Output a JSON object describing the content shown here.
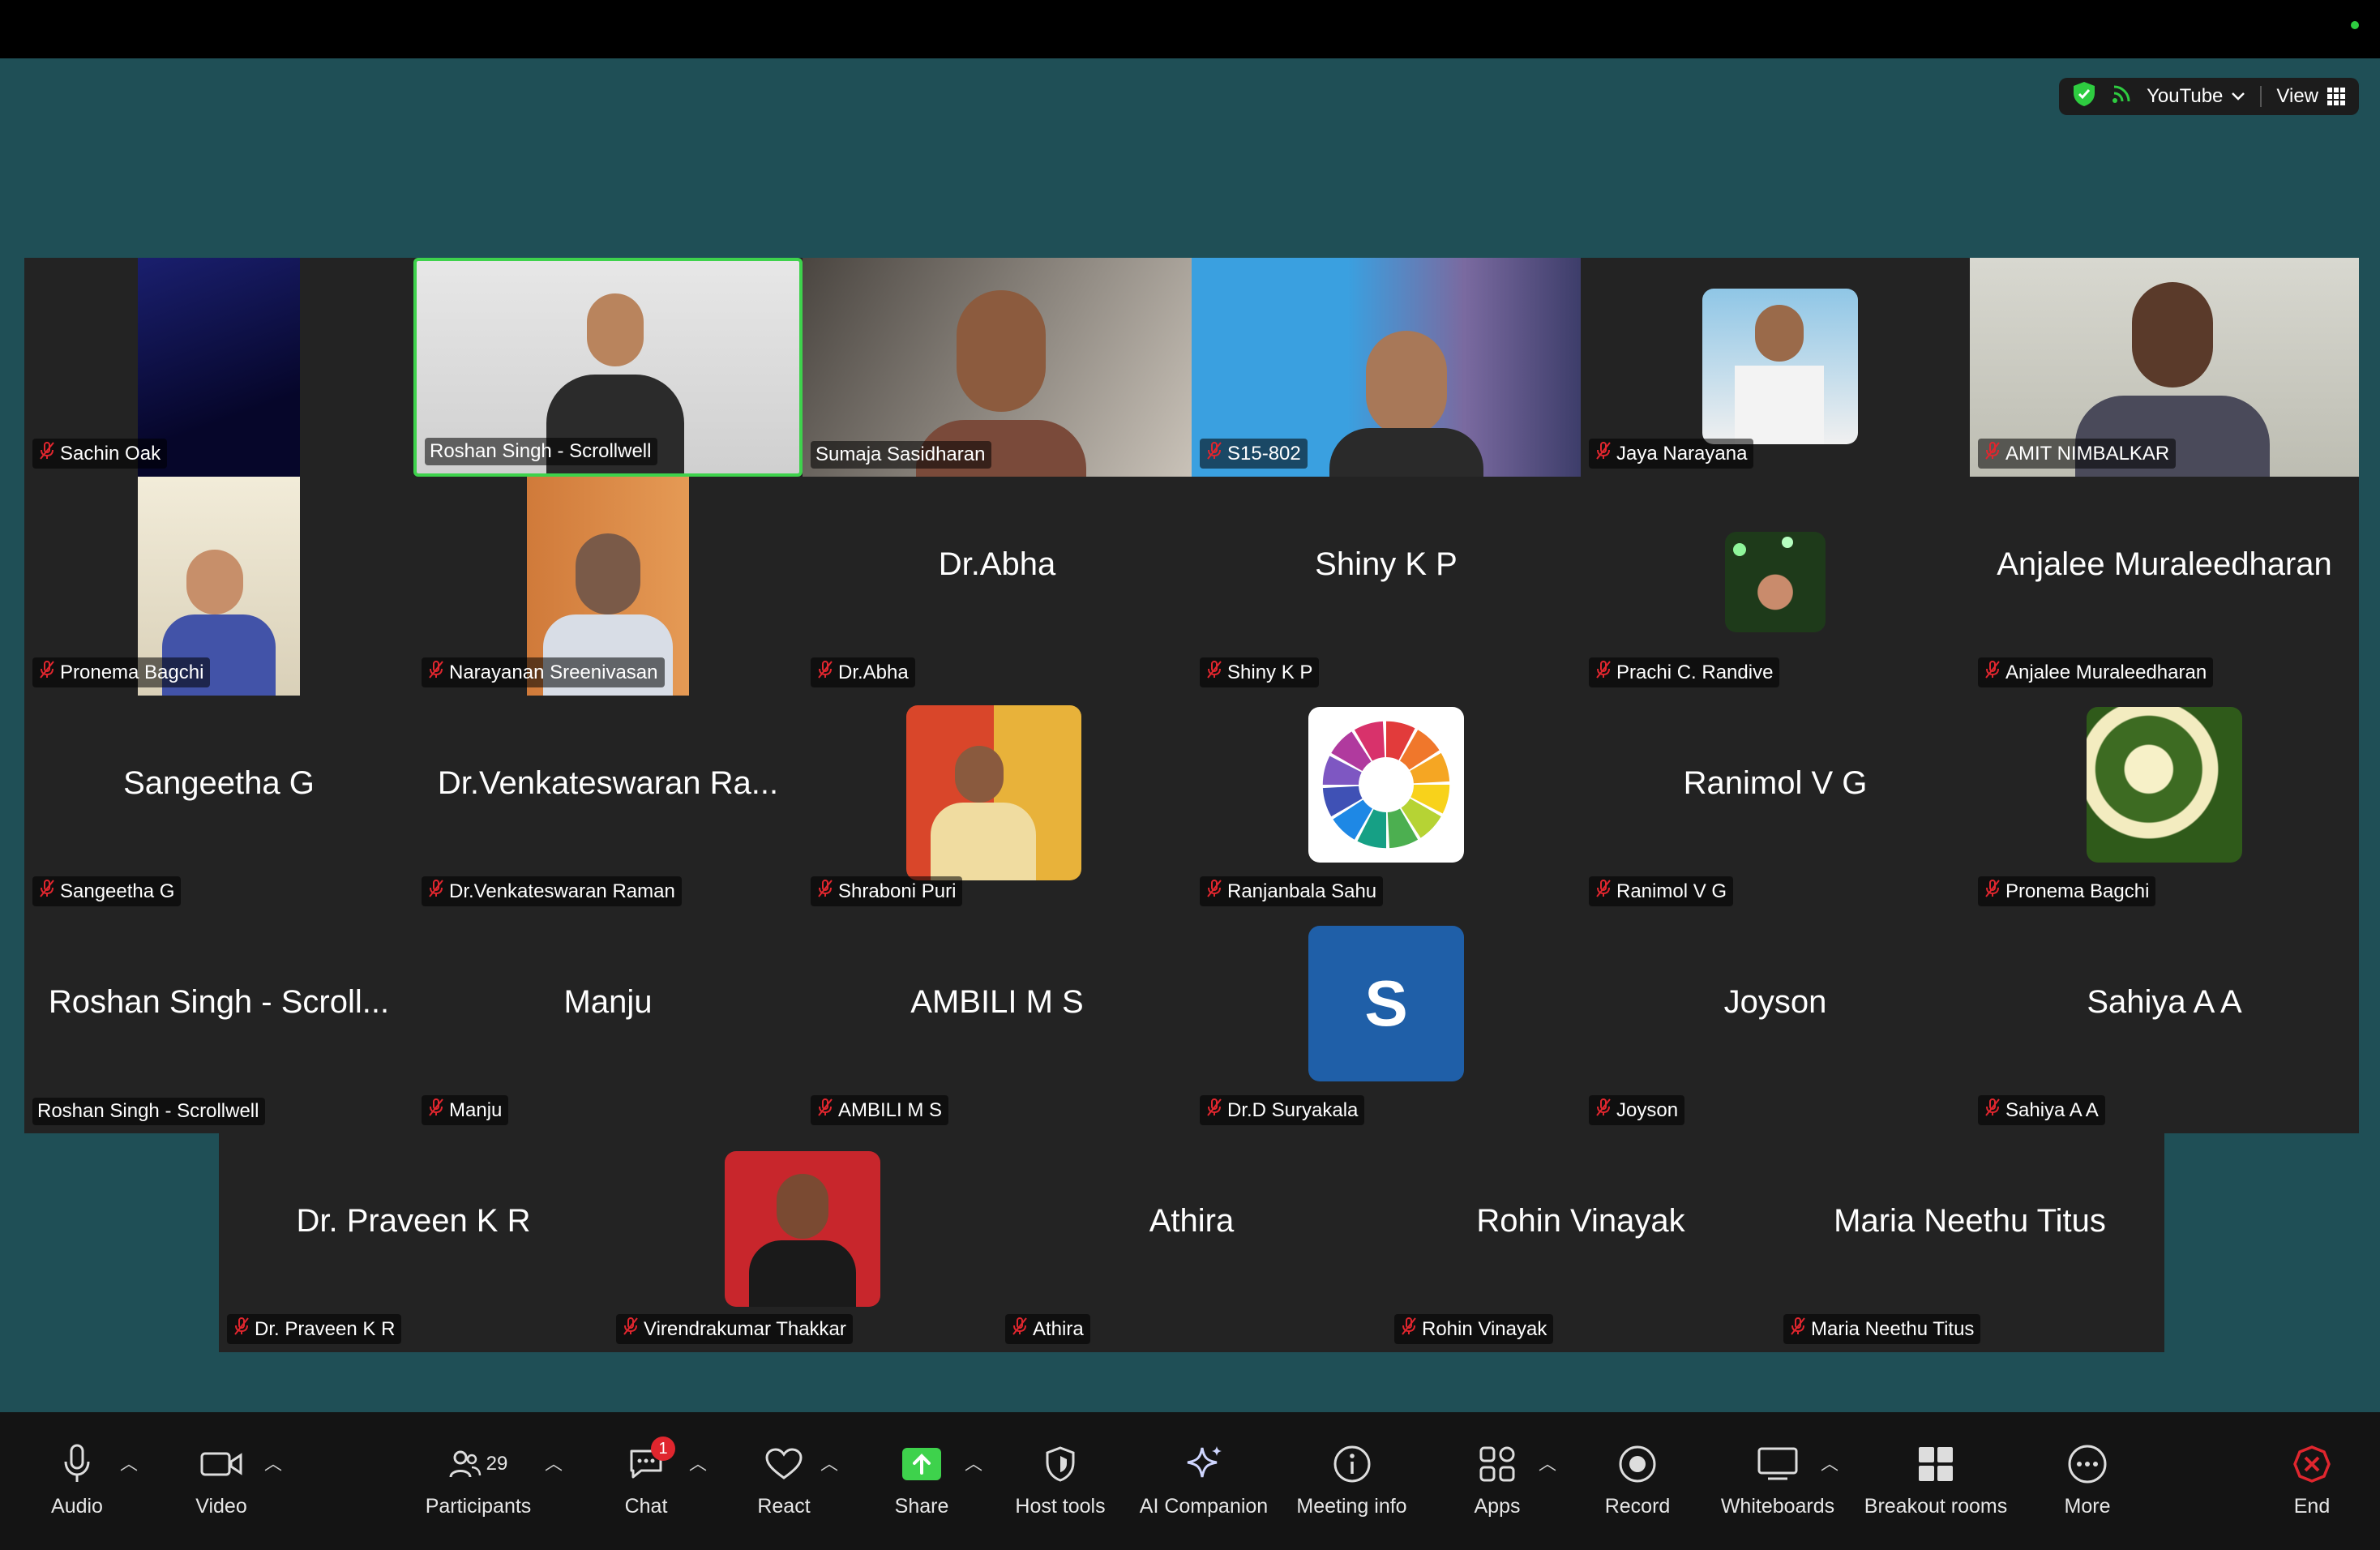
{
  "view_controls": {
    "youtube_label": "YouTube",
    "view_label": "View"
  },
  "gallery": {
    "rows": [
      [
        {
          "name": "Sachin Oak",
          "display": "",
          "kind": "video",
          "muted": true
        },
        {
          "name": "Roshan Singh - Scrollwell",
          "display": "",
          "kind": "video",
          "muted": false,
          "active": true
        },
        {
          "name": "Sumaja Sasidharan",
          "display": "",
          "kind": "video",
          "muted": false
        },
        {
          "name": "S15-802",
          "display": "",
          "kind": "video",
          "muted": true
        },
        {
          "name": "Jaya Narayana",
          "display": "",
          "kind": "photo",
          "muted": true
        },
        {
          "name": "AMIT NIMBALKAR",
          "display": "",
          "kind": "video",
          "muted": true
        }
      ],
      [
        {
          "name": "Pronema Bagchi",
          "display": "",
          "kind": "video",
          "muted": true
        },
        {
          "name": "Narayanan Sreenivasan",
          "display": "",
          "kind": "video",
          "muted": true
        },
        {
          "name": "Dr.Abha",
          "display": "Dr.Abha",
          "kind": "name",
          "muted": true
        },
        {
          "name": "Shiny K P",
          "display": "Shiny K P",
          "kind": "name",
          "muted": true
        },
        {
          "name": "Prachi C. Randive",
          "display": "",
          "kind": "photo",
          "muted": true
        },
        {
          "name": "Anjalee Muraleedharan",
          "display": "Anjalee Muraleedharan",
          "kind": "name",
          "muted": true
        }
      ],
      [
        {
          "name": "Sangeetha G",
          "display": "Sangeetha G",
          "kind": "name",
          "muted": true
        },
        {
          "name": "Dr.Venkateswaran Raman",
          "display": "Dr.Venkateswaran Ra...",
          "kind": "name",
          "muted": true
        },
        {
          "name": "Shraboni Puri",
          "display": "",
          "kind": "photo",
          "muted": true
        },
        {
          "name": "Ranjanbala Sahu",
          "display": "",
          "kind": "wheel",
          "muted": true
        },
        {
          "name": "Ranimol V G",
          "display": "Ranimol V G",
          "kind": "name",
          "muted": true
        },
        {
          "name": "Pronema Bagchi",
          "display": "",
          "kind": "flowers",
          "muted": true
        }
      ],
      [
        {
          "name": "Roshan Singh - Scrollwell",
          "display": "Roshan Singh - Scroll...",
          "kind": "name",
          "muted": false
        },
        {
          "name": "Manju",
          "display": "Manju",
          "kind": "name",
          "muted": true
        },
        {
          "name": "AMBILI M S",
          "display": "AMBILI M S",
          "kind": "name",
          "muted": true
        },
        {
          "name": "Dr.D Suryakala",
          "display": "S",
          "kind": "initial",
          "muted": true
        },
        {
          "name": "Joyson",
          "display": "Joyson",
          "kind": "name",
          "muted": true
        },
        {
          "name": "Sahiya A A",
          "display": "Sahiya A A",
          "kind": "name",
          "muted": true
        }
      ],
      [
        {
          "name": "Dr. Praveen K R",
          "display": "Dr. Praveen K R",
          "kind": "name",
          "muted": true
        },
        {
          "name": "Virendrakumar Thakkar",
          "display": "",
          "kind": "photo",
          "muted": true
        },
        {
          "name": "Athira",
          "display": "Athira",
          "kind": "name",
          "muted": true
        },
        {
          "name": "Rohin Vinayak",
          "display": "Rohin Vinayak",
          "kind": "name",
          "muted": true
        },
        {
          "name": "Maria Neethu Titus",
          "display": "Maria Neethu Titus",
          "kind": "name",
          "muted": true
        }
      ]
    ]
  },
  "toolbar": {
    "audio": "Audio",
    "video": "Video",
    "participants": "Participants",
    "participants_count": "29",
    "chat": "Chat",
    "chat_badge": "1",
    "react": "React",
    "share": "Share",
    "host_tools": "Host tools",
    "ai_companion": "AI Companion",
    "meeting_info": "Meeting info",
    "apps": "Apps",
    "record": "Record",
    "whiteboards": "Whiteboards",
    "breakout_rooms": "Breakout rooms",
    "more": "More",
    "end": "End"
  },
  "colors": {
    "background": "#1f4f56",
    "tile": "#232323",
    "active_border": "#3ed24c",
    "mute_red": "#e0262e",
    "share_green": "#3ed24c",
    "end_red": "#e0262e",
    "initial_tile": "#1f5fa8"
  }
}
